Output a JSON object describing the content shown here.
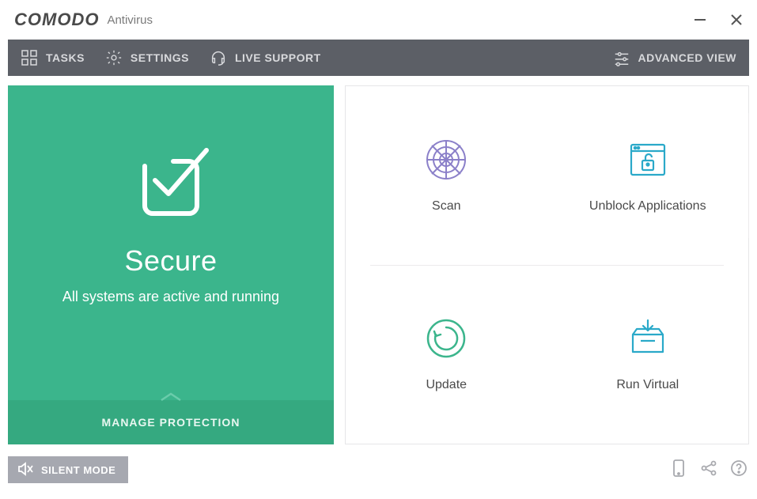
{
  "app": {
    "brand": "COMODO",
    "product": "Antivirus"
  },
  "toolbar": {
    "tasks": "TASKS",
    "settings": "SETTINGS",
    "liveSupport": "LIVE SUPPORT",
    "advancedView": "ADVANCED VIEW"
  },
  "status": {
    "title": "Secure",
    "subtitle": "All systems are active and running",
    "manage": "MANAGE PROTECTION"
  },
  "tiles": {
    "scan": "Scan",
    "unblock": "Unblock Applications",
    "update": "Update",
    "runVirtual": "Run Virtual"
  },
  "footer": {
    "silentMode": "SILENT MODE"
  },
  "colors": {
    "accentGreen": "#3bb58c",
    "toolbarGray": "#5c5f66",
    "iconPurple": "#8b80c9",
    "iconCyan": "#2aa9c9",
    "iconGreen": "#3bb58c"
  }
}
